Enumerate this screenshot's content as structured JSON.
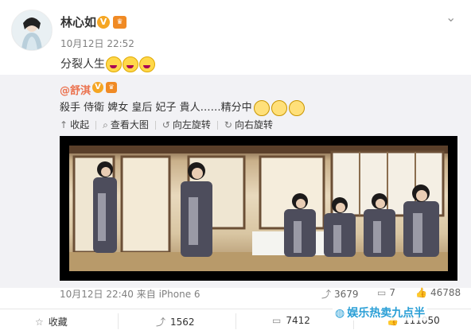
{
  "post": {
    "author": "林心如",
    "v_badge": "V",
    "crown_badge": "♛",
    "meta": "10月12日 22:52",
    "text": "分裂人生",
    "emoji_count": 3,
    "chevron": "⌄"
  },
  "quoted": {
    "user": "@舒淇",
    "v_badge": "V",
    "crown_badge": "♛",
    "text": "殺手 侍衛 婢女 皇后 妃子 貴人……精分中",
    "emoji_count": 3,
    "tools": {
      "collapse": "收起",
      "view_large": "查看大图",
      "rotate_left": "向左旋转",
      "rotate_right": "向右旋转"
    },
    "date": "10月12日 22:40 来自 iPhone 6",
    "reposts": "3679",
    "comments": "7",
    "likes": "46788"
  },
  "actions": {
    "favorite": "收藏",
    "repost": "1562",
    "comment": "7412",
    "like": "111050"
  },
  "watermark": "娱乐热卖九点半",
  "colors": {
    "link_orange": "#eb7350",
    "quote_bg": "#f2f2f5",
    "badge_gold": "#f5a623",
    "watermark_blue": "#2a9fd6"
  },
  "icons": {
    "collapse": "up-arrow-icon",
    "view_large": "magnify-icon",
    "rotate_left": "rotate-left-icon",
    "rotate_right": "rotate-right-icon",
    "repost": "repost-icon",
    "comment": "comment-icon",
    "like": "thumb-up-icon",
    "favorite": "star-icon"
  }
}
